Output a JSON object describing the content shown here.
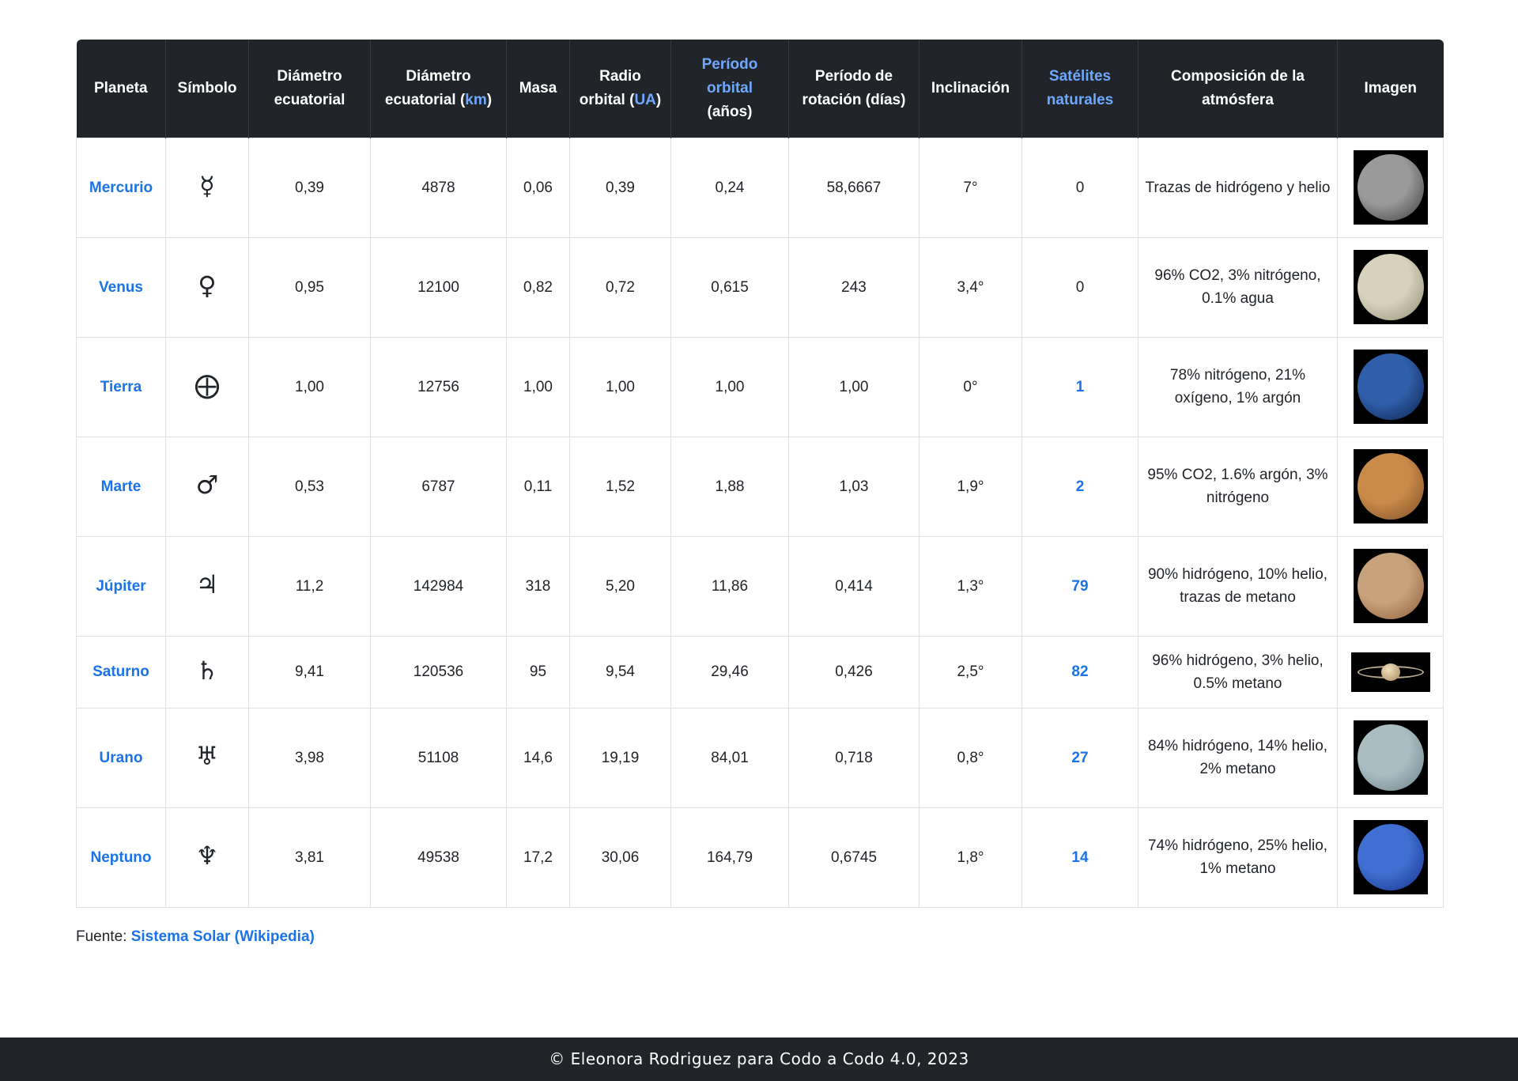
{
  "table": {
    "headers": {
      "planeta": "Planeta",
      "simbolo": "Símbolo",
      "diam_ecuatorial": "Diámetro ecuatorial",
      "diam_km_prefix": "Diámetro ecuatorial (",
      "diam_km_link": "km",
      "diam_km_suffix": ")",
      "masa": "Masa",
      "radio_prefix": "Radio orbital (",
      "radio_link": "UA",
      "radio_suffix": ")",
      "periodo_orbital_link": "Período orbital",
      "periodo_orbital_suffix": "(años)",
      "periodo_rotacion": "Período de rotación (días)",
      "inclinacion": "Inclinación",
      "satelites": "Satélites naturales",
      "composicion": "Composición de la atmósfera",
      "imagen": "Imagen"
    },
    "rows": [
      {
        "name": "Mercurio",
        "symbol": "☿",
        "diam": "0,39",
        "diam_km": "4878",
        "mass": "0,06",
        "radius": "0,39",
        "orbital": "0,24",
        "rotation": "58,6667",
        "incl": "7°",
        "sats": "0",
        "atmos": "Trazas de hidrógeno y helio",
        "img": "mercury-image"
      },
      {
        "name": "Venus",
        "symbol": "♀",
        "diam": "0,95",
        "diam_km": "12100",
        "mass": "0,82",
        "radius": "0,72",
        "orbital": "0,615",
        "rotation": "243",
        "incl": "3,4°",
        "sats": "0",
        "atmos": "96% CO2, 3% nitrógeno, 0.1% agua",
        "img": "venus-image"
      },
      {
        "name": "Tierra",
        "symbol": "⨁",
        "diam": "1,00",
        "diam_km": "12756",
        "mass": "1,00",
        "radius": "1,00",
        "orbital": "1,00",
        "rotation": "1,00",
        "incl": "0°",
        "sats": "1",
        "atmos": "78% nitrógeno, 21% oxígeno, 1% argón",
        "img": "earth-image"
      },
      {
        "name": "Marte",
        "symbol": "♂",
        "diam": "0,53",
        "diam_km": "6787",
        "mass": "0,11",
        "radius": "1,52",
        "orbital": "1,88",
        "rotation": "1,03",
        "incl": "1,9°",
        "sats": "2",
        "atmos": "95% CO2, 1.6% argón, 3% nitrógeno",
        "img": "mars-image"
      },
      {
        "name": "Júpiter",
        "symbol": "♃",
        "diam": "11,2",
        "diam_km": "142984",
        "mass": "318",
        "radius": "5,20",
        "orbital": "11,86",
        "rotation": "0,414",
        "incl": "1,3°",
        "sats": "79",
        "atmos": "90% hidrógeno, 10% helio, trazas de metano",
        "img": "jupiter-image"
      },
      {
        "name": "Saturno",
        "symbol": "♄",
        "diam": "9,41",
        "diam_km": "120536",
        "mass": "95",
        "radius": "9,54",
        "orbital": "29,46",
        "rotation": "0,426",
        "incl": "2,5°",
        "sats": "82",
        "atmos": "96% hidrógeno, 3% helio, 0.5% metano",
        "img": "saturn-image"
      },
      {
        "name": "Urano",
        "symbol": "♅",
        "diam": "3,98",
        "diam_km": "51108",
        "mass": "14,6",
        "radius": "19,19",
        "orbital": "84,01",
        "rotation": "0,718",
        "incl": "0,8°",
        "sats": "27",
        "atmos": "84% hidrógeno, 14% helio, 2% metano",
        "img": "uranus-image"
      },
      {
        "name": "Neptuno",
        "symbol": "♆",
        "diam": "3,81",
        "diam_km": "49538",
        "mass": "17,2",
        "radius": "30,06",
        "orbital": "164,79",
        "rotation": "0,6745",
        "incl": "1,8°",
        "sats": "14",
        "atmos": "74% hidrógeno, 25% helio, 1% metano",
        "img": "neptune-image"
      }
    ]
  },
  "source": {
    "prefix": "Fuente: ",
    "link": "Sistema Solar (Wikipedia)"
  },
  "footer": {
    "text": "© Eleonora Rodriguez para Codo a Codo 4.0, 2023"
  },
  "colors": {
    "header_bg": "#212529",
    "link": "#1a73e8",
    "header_link": "#6ea8fe",
    "footer_bg": "#212529"
  },
  "planet_colors": [
    "#9a9a9a",
    "#d8d2bd",
    "#2f5fa8",
    "#c98a4a",
    "#c8a27a",
    "#d6c7a0",
    "#a9bdc3",
    "#3f6fd1"
  ],
  "planet_colors_dark": [
    "#3a3a3a",
    "#8f8a70",
    "#0c1e4a",
    "#7a4a22",
    "#8a5a3a",
    "#8a7a5a",
    "#6b7f86",
    "#16308a"
  ]
}
